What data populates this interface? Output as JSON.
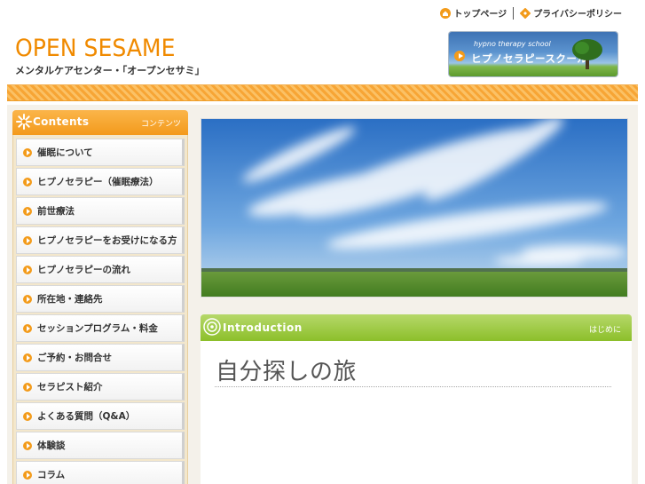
{
  "header": {
    "links": [
      {
        "label": "トップページ",
        "icon": "home-icon"
      },
      {
        "label": "プライバシーポリシー",
        "icon": "privacy-icon"
      }
    ],
    "logo_main": "OPEN SESAME",
    "logo_sub": "メンタルケアセンター・「オープンセサミ」",
    "school_banner": {
      "small": "hypno therapy school",
      "big": "ヒプノセラピースクール"
    }
  },
  "sidebar": {
    "title_en": "Contents",
    "title_jp": "コンテンツ",
    "items": [
      {
        "label": "催眠について"
      },
      {
        "label": "ヒプノセラピー（催眠療法）"
      },
      {
        "label": "前世療法"
      },
      {
        "label": "ヒプノセラピーをお受けになる方"
      },
      {
        "label": "ヒプノセラピーの流れ"
      },
      {
        "label": "所在地・連絡先"
      },
      {
        "label": "セッションプログラム・料金"
      },
      {
        "label": "ご予約・お問合せ"
      },
      {
        "label": "セラピスト紹介"
      },
      {
        "label": "よくある質問（Q&A）"
      },
      {
        "label": "体験談"
      },
      {
        "label": "コラム"
      }
    ]
  },
  "intro": {
    "title_en": "Introduction",
    "title_jp": "はじめに",
    "heading": "自分探しの旅"
  },
  "colors": {
    "accent_orange": "#f39a1c",
    "accent_green": "#8cbf2a",
    "logo_orange": "#f08a00"
  }
}
